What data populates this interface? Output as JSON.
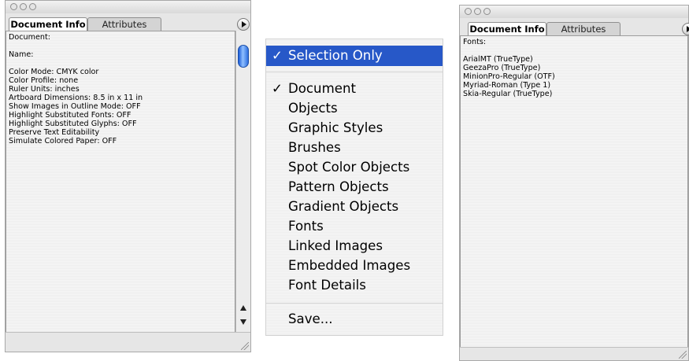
{
  "left_panel": {
    "tabs": [
      "Document Info",
      "Attributes"
    ],
    "lines": [
      "Document:",
      "",
      "Name:",
      "",
      "Color Mode: CMYK color",
      "Color Profile: none",
      "Ruler Units: inches",
      "Artboard Dimensions: 8.5 in x 11 in",
      "Show Images in Outline Mode: OFF",
      "Highlight Substituted Fonts: OFF",
      "Highlight Substituted Glyphs: OFF",
      "Preserve Text Editability",
      "Simulate Colored Paper: OFF"
    ]
  },
  "menu": {
    "items": [
      {
        "label": "Selection Only",
        "checked": true,
        "highlighted": true
      },
      {
        "label": "Document",
        "checked": true,
        "highlighted": false
      },
      {
        "label": "Objects",
        "checked": false,
        "highlighted": false
      },
      {
        "label": "Graphic Styles",
        "checked": false,
        "highlighted": false
      },
      {
        "label": "Brushes",
        "checked": false,
        "highlighted": false
      },
      {
        "label": "Spot Color Objects",
        "checked": false,
        "highlighted": false
      },
      {
        "label": "Pattern Objects",
        "checked": false,
        "highlighted": false
      },
      {
        "label": "Gradient Objects",
        "checked": false,
        "highlighted": false
      },
      {
        "label": "Fonts",
        "checked": false,
        "highlighted": false
      },
      {
        "label": "Linked Images",
        "checked": false,
        "highlighted": false
      },
      {
        "label": "Embedded Images",
        "checked": false,
        "highlighted": false
      },
      {
        "label": "Font Details",
        "checked": false,
        "highlighted": false
      },
      {
        "label": "Save...",
        "checked": false,
        "highlighted": false
      }
    ],
    "check_glyph": "✓"
  },
  "right_panel": {
    "tabs": [
      "Document Info",
      "Attributes"
    ],
    "lines": [
      "Fonts:",
      "",
      "ArialMT (TrueType)",
      "GeezaPro (TrueType)",
      "MinionPro-Regular (OTF)",
      "Myriad-Roman (Type 1)",
      "Skia-Regular (TrueType)"
    ]
  },
  "colors": {
    "menu_highlight": "#2758c8",
    "scroll_thumb": "#3b7bea"
  }
}
